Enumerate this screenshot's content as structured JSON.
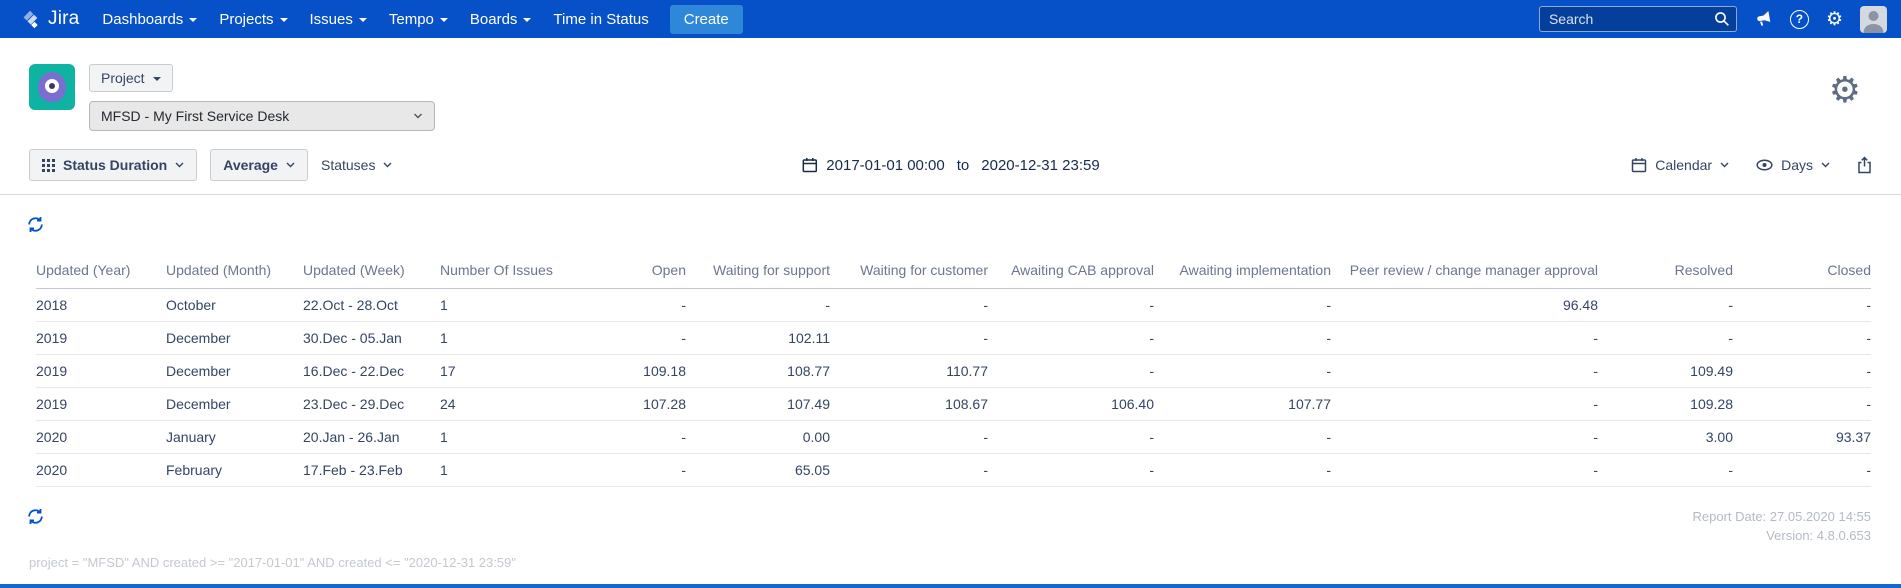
{
  "navbar": {
    "logo": "Jira",
    "items": [
      {
        "label": "Dashboards"
      },
      {
        "label": "Projects"
      },
      {
        "label": "Issues"
      },
      {
        "label": "Tempo"
      },
      {
        "label": "Boards"
      },
      {
        "label": "Time in Status"
      }
    ],
    "create": "Create",
    "search_placeholder": "Search"
  },
  "project_header": {
    "project_button": "Project",
    "selected_project": "MFSD - My First Service Desk"
  },
  "toolbar": {
    "report_type": "Status Duration",
    "metric": "Average",
    "statuses": "Statuses",
    "date_from": "2017-01-01 00:00",
    "to_label": "to",
    "date_to": "2020-12-31 23:59",
    "calendar": "Calendar",
    "unit": "Days"
  },
  "table": {
    "columns": [
      "Updated (Year)",
      "Updated (Month)",
      "Updated (Week)",
      "Number Of Issues",
      "Open",
      "Waiting for support",
      "Waiting for customer",
      "Awaiting CAB approval",
      "Awaiting implementation",
      "Peer review / change manager approval",
      "Resolved",
      "Closed"
    ],
    "rows": [
      [
        "2018",
        "October",
        "22.Oct - 28.Oct",
        "1",
        "-",
        "-",
        "-",
        "-",
        "-",
        "96.48",
        "-",
        "-"
      ],
      [
        "2019",
        "December",
        "30.Dec - 05.Jan",
        "1",
        "-",
        "102.11",
        "-",
        "-",
        "-",
        "-",
        "-",
        "-"
      ],
      [
        "2019",
        "December",
        "16.Dec - 22.Dec",
        "17",
        "109.18",
        "108.77",
        "110.77",
        "-",
        "-",
        "-",
        "109.49",
        "-"
      ],
      [
        "2019",
        "December",
        "23.Dec - 29.Dec",
        "24",
        "107.28",
        "107.49",
        "108.67",
        "106.40",
        "107.77",
        "-",
        "109.28",
        "-"
      ],
      [
        "2020",
        "January",
        "20.Jan - 26.Jan",
        "1",
        "-",
        "0.00",
        "-",
        "-",
        "-",
        "-",
        "3.00",
        "93.37"
      ],
      [
        "2020",
        "February",
        "17.Feb - 23.Feb",
        "1",
        "-",
        "65.05",
        "-",
        "-",
        "-",
        "-",
        "-",
        "-"
      ]
    ]
  },
  "footer": {
    "report_date": "Report Date: 27.05.2020 14:55",
    "version": "Version: 4.8.0.653",
    "jql": "project = \"MFSD\" AND created >= \"2017-01-01\" AND created <= \"2020-12-31 23:59\""
  },
  "icons": {
    "gear_glyph": "⚙",
    "help_glyph": "?"
  },
  "colors": {
    "navbar_bg": "#0751c8",
    "create_bg": "#2e87d8",
    "accent_blue": "#0052cc"
  }
}
